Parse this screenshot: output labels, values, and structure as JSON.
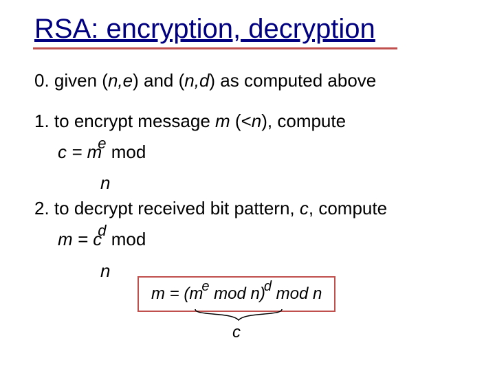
{
  "title": "RSA: encryption, decryption",
  "step0_pre": "0.  given (",
  "step0_n1": "n,",
  "step0_e": "e",
  "step0_mid": ") and (",
  "step0_n2": "n,",
  "step0_d": "d",
  "step0_post": ") as computed above",
  "step1_text_a": "1. to encrypt message ",
  "step1_m": "m",
  "step1_text_b": " (<",
  "step1_n": "n",
  "step1_text_c": "), compute",
  "eq1_c": "c = m",
  "eq1_exp": "e",
  "eq1_mod": "   mod",
  "eq1_n": "n",
  "step2_text_a": "2. to decrypt received bit pattern, ",
  "step2_c": "c",
  "step2_text_b": ", compute",
  "eq2_m": "m = c",
  "eq2_exp": "d",
  "eq2_mod": "   mod",
  "eq2_n": "n",
  "box_a": "m  =  (m",
  "box_e": "e",
  "box_b": " mod  n)",
  "box_d": "d",
  "box_c": " mod  n",
  "brace_label": "c"
}
